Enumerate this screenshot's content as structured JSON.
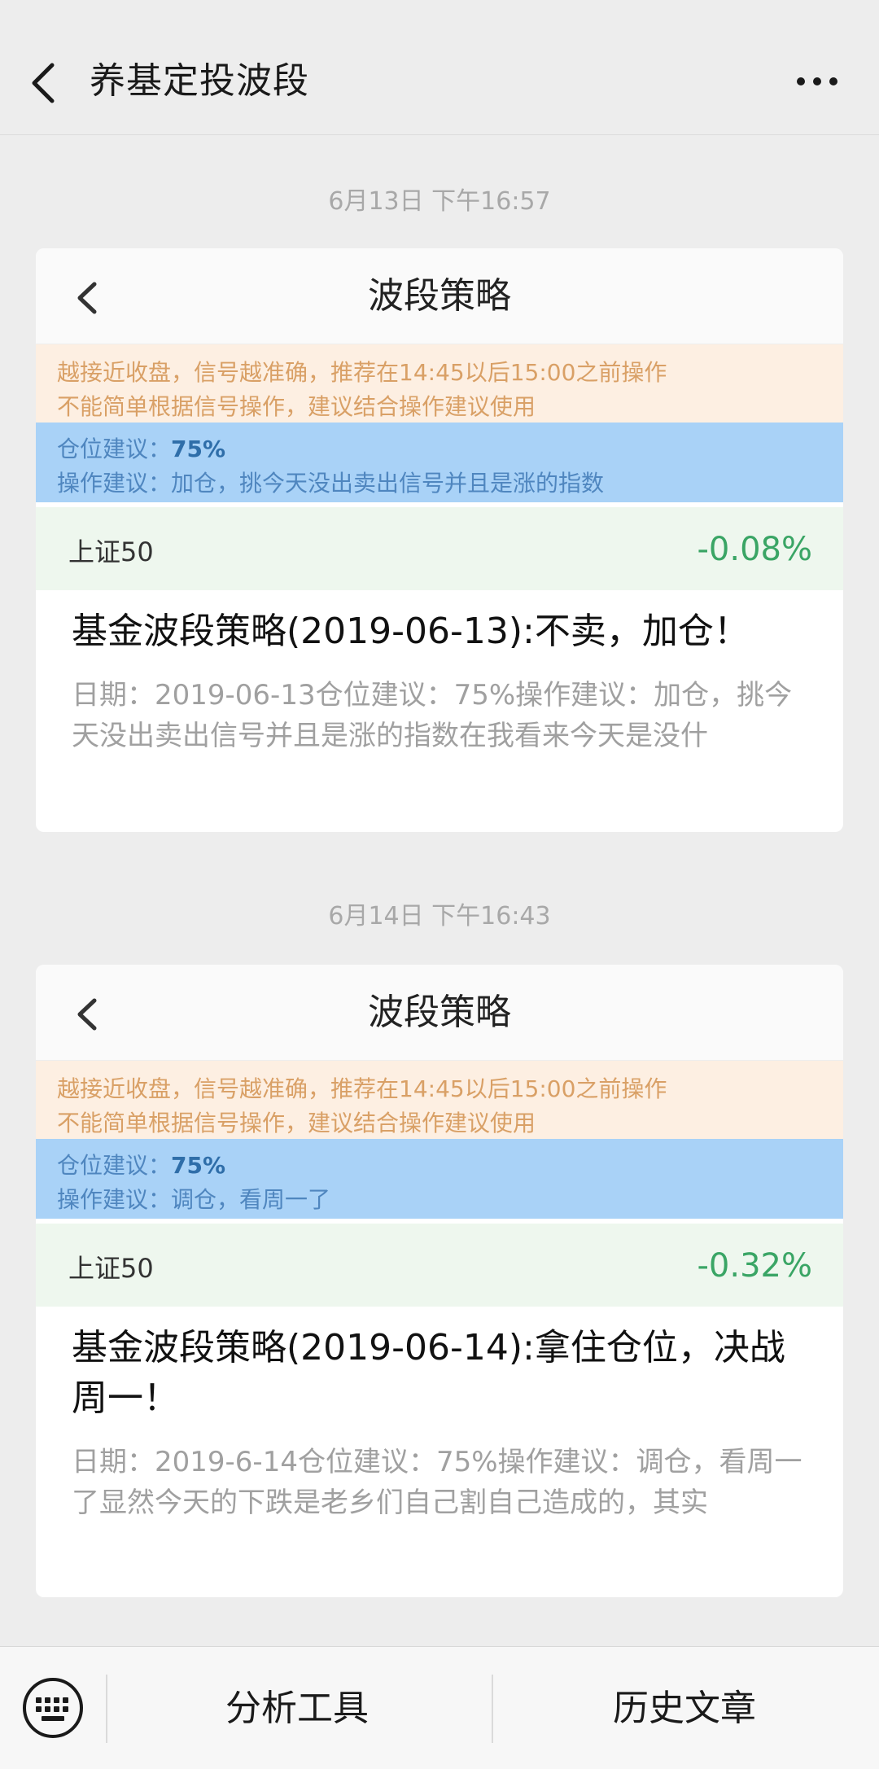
{
  "header": {
    "title": "养基定投波段",
    "back_icon": "chevron-left-icon",
    "more_icon": "more-dots-icon"
  },
  "messages": [
    {
      "time": "6月13日 下午16:57",
      "screenshot": {
        "title": "波段策略",
        "warning_line1": "越接近收盘，信号越准确，推荐在14:45以后15:00之前操作",
        "warning_line2": "不能简单根据信号操作，建议结合操作建议使用",
        "position_label": "仓位建议：",
        "position_value": "75%",
        "operation": "操作建议：加仓，挑今天没出卖出信号并且是涨的指数",
        "index_name": "上证50",
        "index_change": "-0.08%"
      },
      "title": "基金波段策略(2019-06-13):不卖，加仓！",
      "summary": "日期：2019-06-13仓位建议：75%操作建议：加仓，挑今天没出卖出信号并且是涨的指数在我看来今天是没什"
    },
    {
      "time": "6月14日 下午16:43",
      "screenshot": {
        "title": "波段策略",
        "warning_line1": "越接近收盘，信号越准确，推荐在14:45以后15:00之前操作",
        "warning_line2": "不能简单根据信号操作，建议结合操作建议使用",
        "position_label": "仓位建议：",
        "position_value": "75%",
        "operation": "操作建议：调仓，看周一了",
        "index_name": "上证50",
        "index_change": "-0.32%"
      },
      "title": "基金波段策略(2019-06-14):拿住仓位，决战周一！",
      "summary": "日期：2019-6-14仓位建议：75%操作建议：调仓，看周一了显然今天的下跌是老乡们自己割自己造成的，其实"
    }
  ],
  "bottom_menu": {
    "keyboard_icon": "keyboard-icon",
    "item1": "分析工具",
    "item2": "历史文章"
  },
  "colors": {
    "warning_bg": "#fdefe2",
    "advice_bg": "#a9d2f7",
    "index_positive": "#3aa565"
  }
}
